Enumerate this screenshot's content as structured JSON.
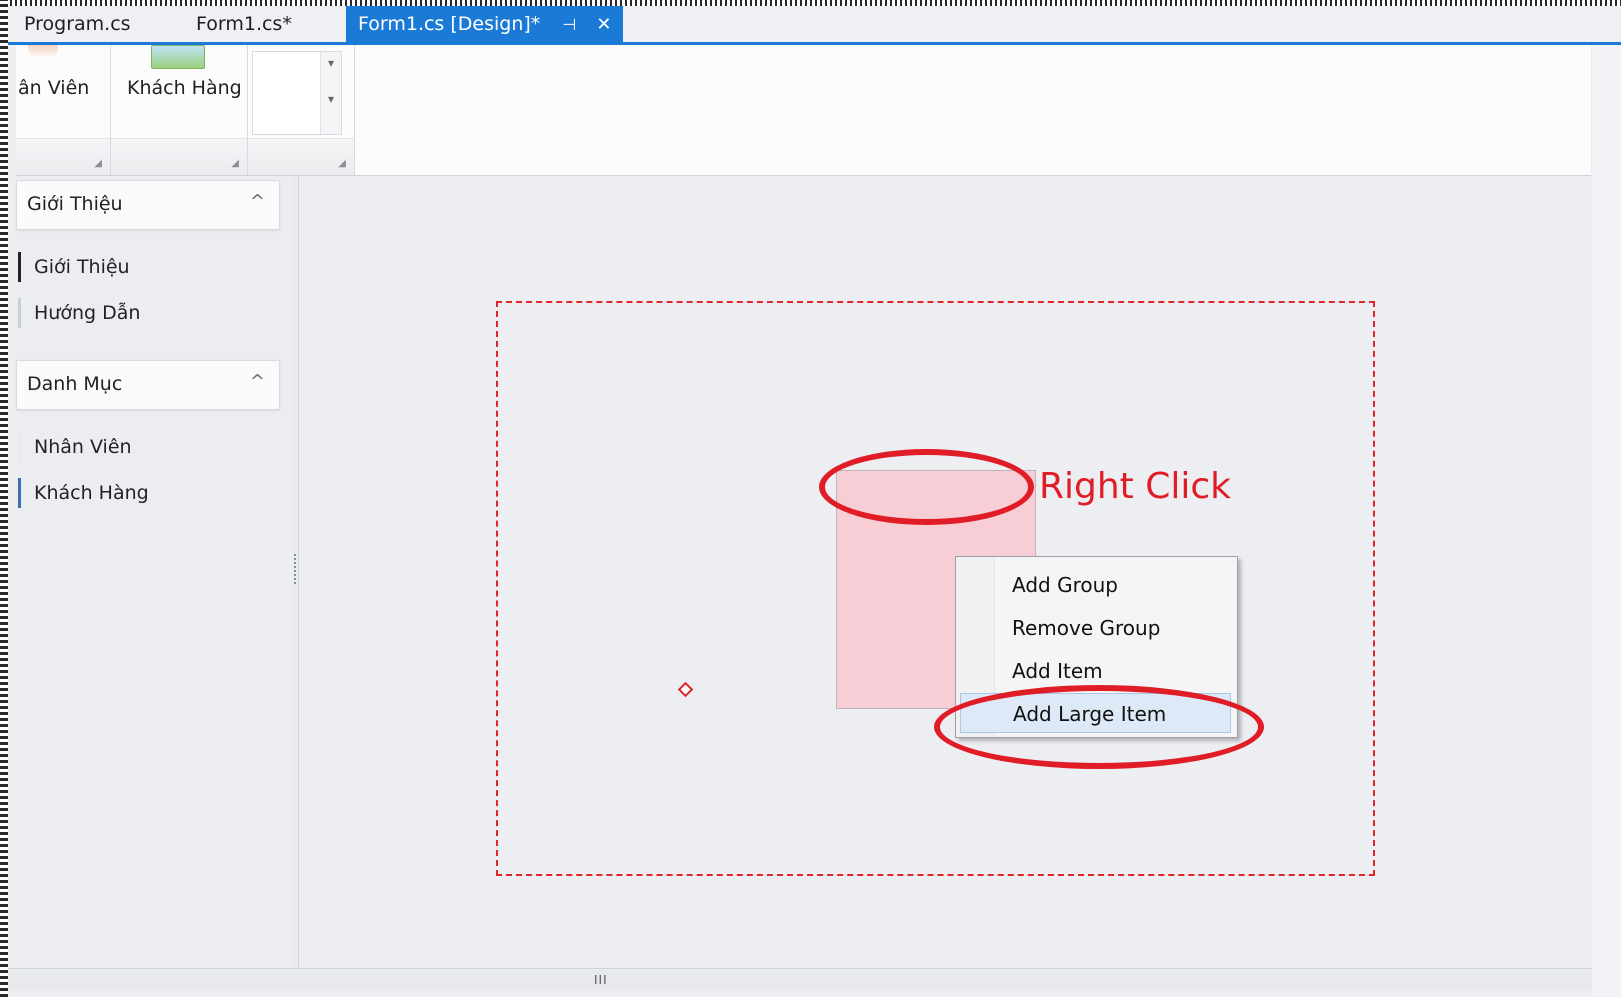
{
  "tabs": [
    {
      "label": "Program.cs",
      "active": false
    },
    {
      "label": "Form1.cs*",
      "active": false
    },
    {
      "label": "Form1.cs [Design]*",
      "active": true
    }
  ],
  "tab_icons": {
    "pin": "⊣",
    "close": "✕"
  },
  "ribbon": {
    "buttons": [
      {
        "label": "ân Viên",
        "icon": "employee-icon"
      },
      {
        "label": "Khách Hàng",
        "icon": "customer-icon"
      }
    ],
    "gallery_arrows": {
      "up": "▾",
      "down": "▾"
    }
  },
  "nav": {
    "groups": [
      {
        "label": "Giới Thiệu",
        "items": [
          "Giới Thiệu",
          "Hướng Dẫn"
        ]
      },
      {
        "label": "Danh Mục",
        "items": [
          "Nhân Viên",
          "Khách Hàng"
        ]
      }
    ],
    "chevron": "^"
  },
  "annotation": {
    "label": "Right Click",
    "color": "#e01d26"
  },
  "context_menu": {
    "items": [
      "Add Group",
      "Remove Group",
      "Add Item",
      "Add Large Item"
    ],
    "highlighted": "Add Large Item"
  },
  "scrollbar": {
    "thumb": "III"
  },
  "colors": {
    "accent": "#1b7ad6",
    "selection": "#e0242a",
    "group_fill": "#f7ced6"
  }
}
